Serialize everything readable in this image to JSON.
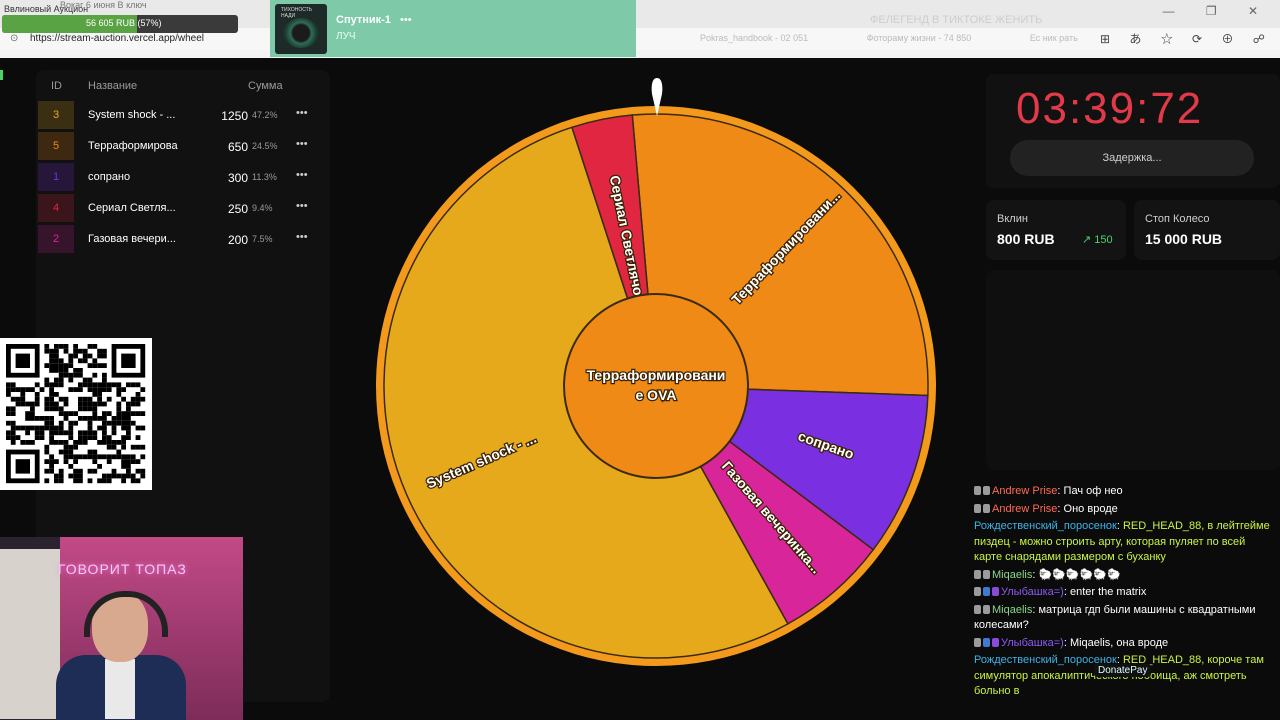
{
  "browser": {
    "tab_title": "Ввлиновый Аукцион",
    "tab_blur": "Вокаг 6 июня В ключ",
    "url": "https://stream-auction.vercel.app/wheel",
    "top_blur": "ФЕЛЕГЕНД В ТИКТОКЕ ЖЕНИТЬ",
    "bookmarks": [
      "Pokras_handbook - 02 051",
      "Фотораму жизни - 74 850",
      "Ес ник рать"
    ],
    "window_controls": "— ❐ ✕",
    "tools": "⊞ あ ☆ ⟳ ⊕ ☍ ◉"
  },
  "progress": {
    "text": "56 605 RUB (57%)",
    "fraction": 0.57
  },
  "now_playing": {
    "title": "Спутник-1",
    "dots": "•••",
    "artist": "ЛУЧ",
    "cover_text": "ТИХОНОСТЬ НАДИ"
  },
  "table": {
    "headers": {
      "id": "ID",
      "name": "Название",
      "sum": "Сумма"
    },
    "rows": [
      {
        "id": "3",
        "name": "System shock - ...",
        "amount": "1250",
        "pct": "47.2%",
        "color": "#e7a91c",
        "more": "•••"
      },
      {
        "id": "5",
        "name": "Терраформирова",
        "amount": "650",
        "pct": "24.5%",
        "color": "#f08a17",
        "more": "•••"
      },
      {
        "id": "1",
        "name": "сопрано",
        "amount": "300",
        "pct": "11.3%",
        "color": "#7a2fe0",
        "more": "•••"
      },
      {
        "id": "4",
        "name": "Сериал Светля...",
        "amount": "250",
        "pct": "9.4%",
        "color": "#e02640",
        "more": "•••"
      },
      {
        "id": "2",
        "name": "Газовая вечери...",
        "amount": "200",
        "pct": "7.5%",
        "color": "#d9259a",
        "more": "•••"
      }
    ]
  },
  "wheel": {
    "center_label": "Терраформировани\nе OVA",
    "segments": [
      {
        "label": "Терраформировани...",
        "color": "#f08a17"
      },
      {
        "label": "сопрано",
        "color": "#7a2fe0"
      },
      {
        "label": "Газовая вечеринка...",
        "color": "#d9259a"
      },
      {
        "label": "System shock - ...",
        "color": "#e7a91c"
      },
      {
        "label": "Сериал Светлячок",
        "color": "#e02640"
      }
    ],
    "rim_color": "#f39a1d"
  },
  "timer": {
    "value": "03:39:72",
    "delay_label": "Задержка..."
  },
  "stats": {
    "vklin_label": "Вклин",
    "vklin_value": "800 RUB",
    "vklin_delta": "150",
    "stop_label": "Стоп Колесо",
    "stop_value": "15 000 RUB"
  },
  "cam": {
    "neon": "ГОВОРИТ ТОПАЗ"
  },
  "chat": [
    {
      "author": "Andrew Prise",
      "author_color": "#ff6b55",
      "text": "Пач оф нео",
      "icons": [
        "g",
        "g"
      ]
    },
    {
      "author": "Andrew Prise",
      "author_color": "#ff6b55",
      "text": "Оно вроде",
      "icons": [
        "g",
        "g"
      ]
    },
    {
      "author": "Рождественский_поросенок",
      "author_color": "#3fb3e8",
      "text": "RED_HEAD_88, в лейтгейме пиздец - можно строить арту, которая пуляет по всей карте снарядами размером с буханку",
      "text_color": "#c8f542",
      "icons": []
    },
    {
      "author": "Miqaelis",
      "author_color": "#8ad68a",
      "text": "🐑🐑🐑🐑🐑🐑",
      "icons": [
        "g",
        "g"
      ]
    },
    {
      "author": "Улыбашка=)",
      "author_color": "#8b5cf6",
      "text": "enter the matrix",
      "icons": [
        "g",
        "b",
        "p"
      ]
    },
    {
      "author": "Miqaelis",
      "author_color": "#8ad68a",
      "text": "матрица гдп были машины с квадратными колесами?",
      "icons": [
        "g",
        "g"
      ]
    },
    {
      "author": "Улыбашка=)",
      "author_color": "#8b5cf6",
      "text": "Miqaelis, она вроде",
      "icons": [
        "g",
        "b",
        "p"
      ]
    },
    {
      "author": "Рождественский_поросенок",
      "author_color": "#3fb3e8",
      "text": "RED_HEAD_88, короче там симулятор апокалиптического побоища, аж смотреть больно в",
      "text_color": "#c8f542",
      "icons": []
    }
  ],
  "donatepay": "DonatePay"
}
